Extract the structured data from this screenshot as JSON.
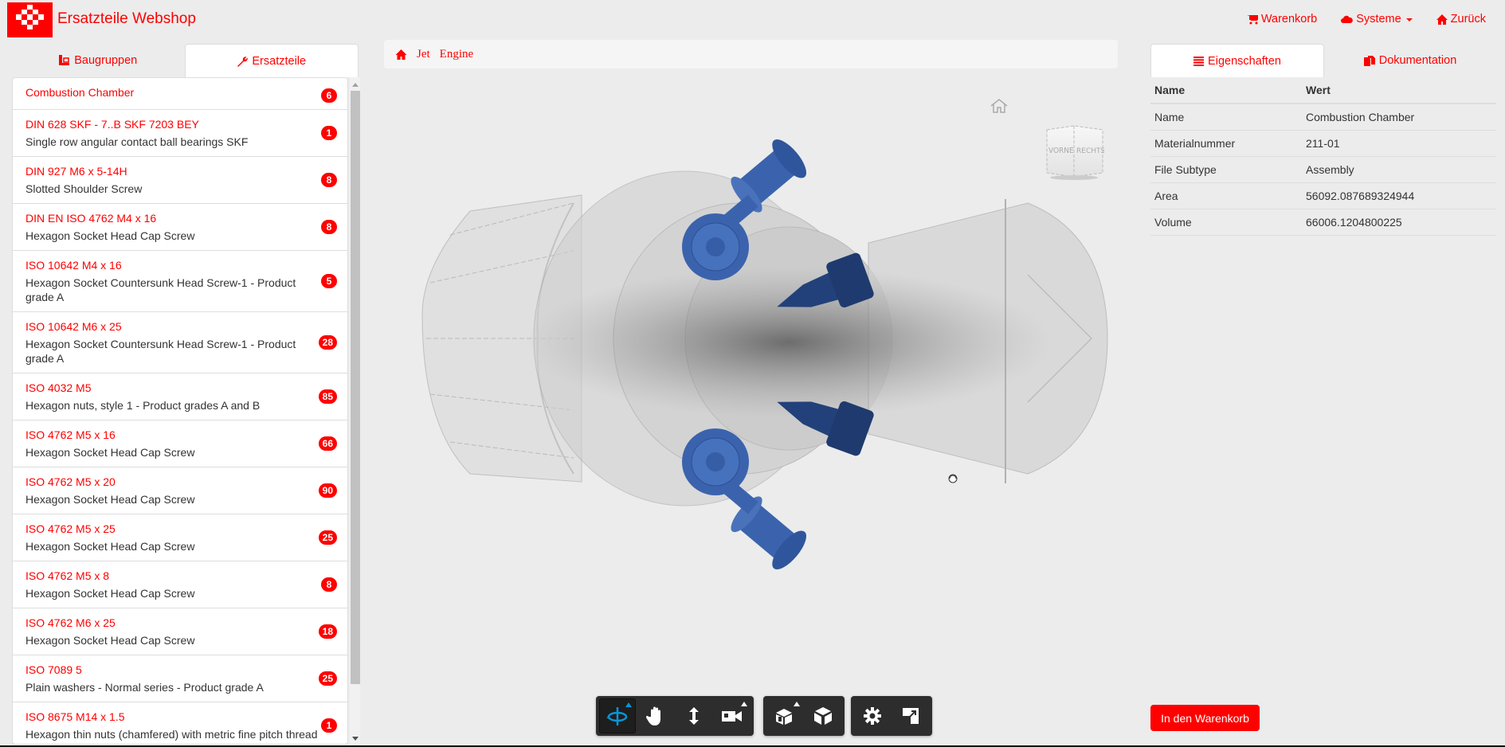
{
  "header": {
    "brand": "Ersatzteile Webshop",
    "nav": [
      {
        "label": "Warenkorb",
        "icon": "cart-icon"
      },
      {
        "label": "Systeme",
        "icon": "cloud-icon",
        "dropdown": true
      },
      {
        "label": "Zurück",
        "icon": "home-icon"
      }
    ]
  },
  "left_tabs": [
    {
      "label": "Baugruppen",
      "icon": "assembly-icon",
      "active": false
    },
    {
      "label": "Ersatzteile",
      "icon": "wrench-icon",
      "active": true
    }
  ],
  "parts": [
    {
      "title": "Combustion Chamber",
      "subtitle": "",
      "count": "6"
    },
    {
      "title": "DIN 628 SKF - 7..B SKF 7203 BEY",
      "subtitle": "Single row angular contact ball bearings SKF",
      "count": "1"
    },
    {
      "title": "DIN 927 M6 x 5-14H",
      "subtitle": "Slotted Shoulder Screw",
      "count": "8"
    },
    {
      "title": "DIN EN ISO 4762 M4 x 16",
      "subtitle": "Hexagon Socket Head Cap Screw",
      "count": "8"
    },
    {
      "title": "ISO 10642 M4 x 16",
      "subtitle": "Hexagon Socket Countersunk Head Screw-1 - Product grade A",
      "count": "5"
    },
    {
      "title": "ISO 10642 M6 x 25",
      "subtitle": "Hexagon Socket Countersunk Head Screw-1 - Product grade A",
      "count": "28"
    },
    {
      "title": "ISO 4032 M5",
      "subtitle": "Hexagon nuts, style 1 - Product grades A and B",
      "count": "85"
    },
    {
      "title": "ISO 4762 M5 x 16",
      "subtitle": "Hexagon Socket Head Cap Screw",
      "count": "66"
    },
    {
      "title": "ISO 4762 M5 x 20",
      "subtitle": "Hexagon Socket Head Cap Screw",
      "count": "90"
    },
    {
      "title": "ISO 4762 M5 x 25",
      "subtitle": "Hexagon Socket Head Cap Screw",
      "count": "25"
    },
    {
      "title": "ISO 4762 M5 x 8",
      "subtitle": "Hexagon Socket Head Cap Screw",
      "count": "8"
    },
    {
      "title": "ISO 4762 M6 x 25",
      "subtitle": "Hexagon Socket Head Cap Screw",
      "count": "18"
    },
    {
      "title": "ISO 7089 5",
      "subtitle": "Plain washers - Normal series - Product grade A",
      "count": "25"
    },
    {
      "title": "ISO 8675 M14 x 1.5",
      "subtitle": "Hexagon thin nuts (chamfered) with metric fine pitch thread",
      "count": "1"
    }
  ],
  "breadcrumb": [
    "Jet",
    "Engine"
  ],
  "viewer": {
    "viewcube_faces": [
      "VORNE",
      "RECHTS"
    ],
    "model_colors": {
      "highlight": "#3b63ad",
      "highlight_dark": "#1f3a6e",
      "ghost": "#9a9a9a"
    },
    "toolbar_groups": [
      [
        {
          "name": "orbit-tool",
          "active": true,
          "submenu": true
        },
        {
          "name": "pan-tool"
        },
        {
          "name": "zoom-tool"
        },
        {
          "name": "camera-tool",
          "submenu": true
        }
      ],
      [
        {
          "name": "explode-tool",
          "submenu": true
        },
        {
          "name": "model-structure-tool"
        }
      ],
      [
        {
          "name": "settings-tool"
        },
        {
          "name": "fullscreen-tool"
        }
      ]
    ]
  },
  "right_tabs": [
    {
      "label": "Eigenschaften",
      "icon": "list-icon",
      "active": true
    },
    {
      "label": "Dokumentation",
      "icon": "documents-icon",
      "active": false
    }
  ],
  "properties": {
    "headers": [
      "Name",
      "Wert"
    ],
    "rows": [
      [
        "Name",
        "Combustion Chamber"
      ],
      [
        "Materialnummer",
        "211-01"
      ],
      [
        "File Subtype",
        "Assembly"
      ],
      [
        "Area",
        "56092.087689324944"
      ],
      [
        "Volume",
        "66006.1204800225"
      ]
    ]
  },
  "add_to_cart_label": "In den Warenkorb",
  "colors": {
    "accent": "#ff0000",
    "background": "#ececec",
    "viewer_active": "#0696d7"
  }
}
